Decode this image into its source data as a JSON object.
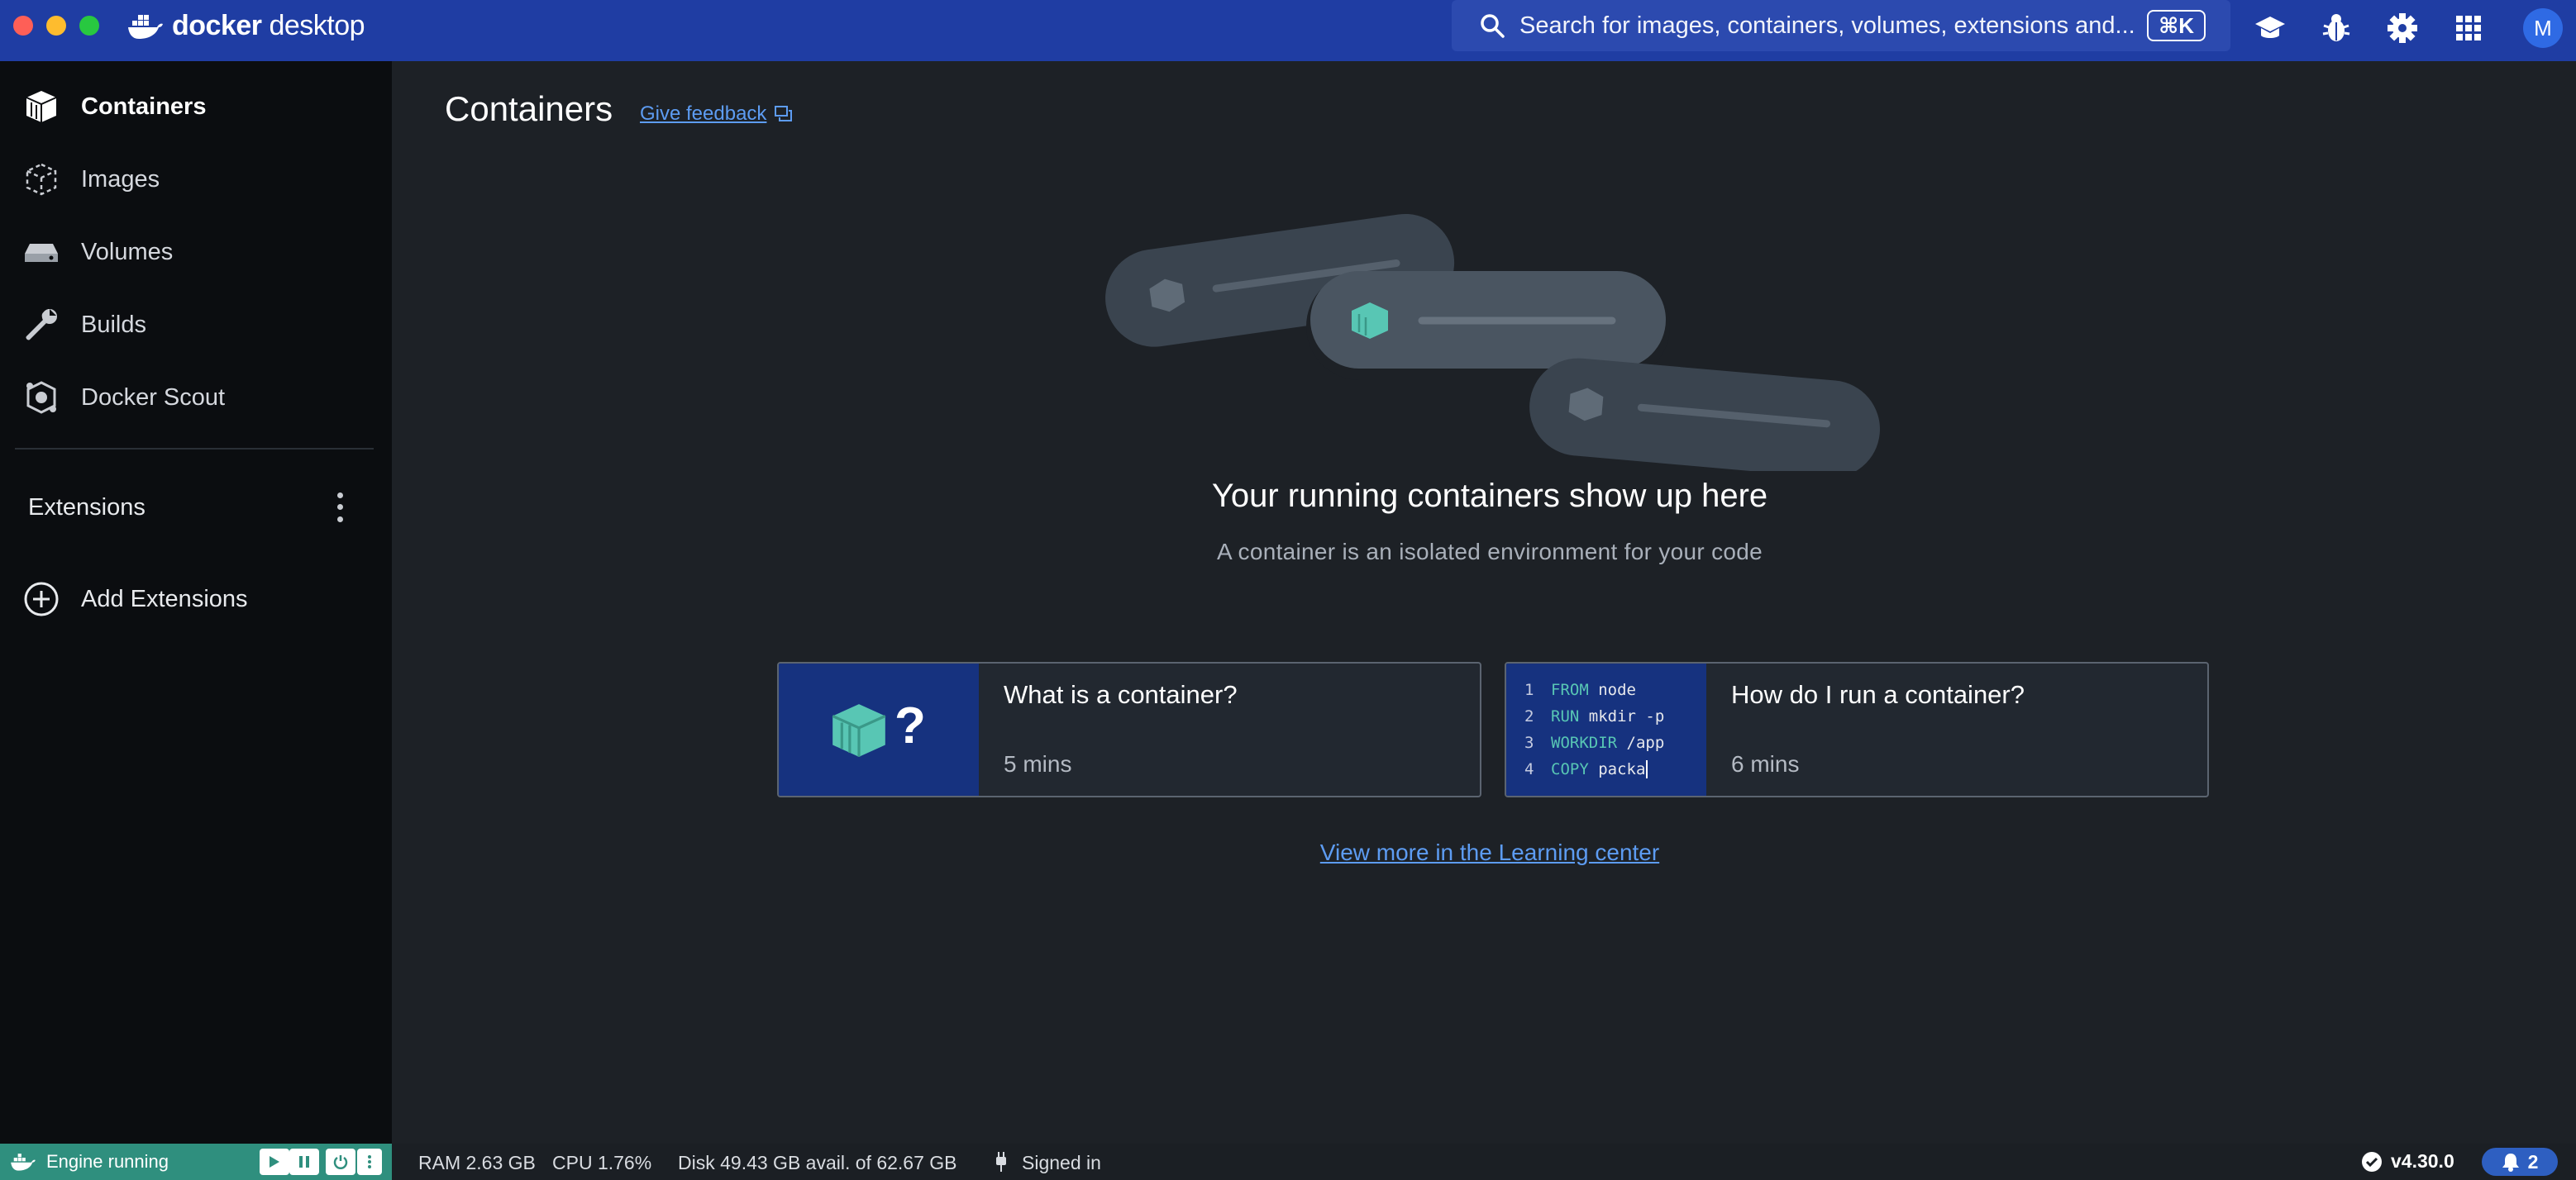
{
  "app": {
    "name_prefix": "docker",
    "name_suffix": "desktop"
  },
  "search": {
    "placeholder": "Search for images, containers, volumes, extensions and...",
    "shortcut": "⌘K"
  },
  "user": {
    "avatar_initial": "M"
  },
  "sidebar": {
    "items": [
      {
        "label": "Containers",
        "icon": "containers-icon"
      },
      {
        "label": "Images",
        "icon": "images-icon"
      },
      {
        "label": "Volumes",
        "icon": "volumes-icon"
      },
      {
        "label": "Builds",
        "icon": "wrench-icon"
      },
      {
        "label": "Docker Scout",
        "icon": "scout-icon"
      }
    ],
    "extensions_label": "Extensions",
    "add_extensions_label": "Add Extensions"
  },
  "main": {
    "title": "Containers",
    "feedback": "Give feedback",
    "empty_title": "Your running containers show up here",
    "empty_subtitle": "A container is an isolated environment for your code",
    "cards": [
      {
        "title": "What is a container?",
        "meta": "5 mins",
        "thumb_symbol": "?"
      },
      {
        "title": "How do I run a container?",
        "meta": "6 mins",
        "code": [
          {
            "n": "1",
            "kw": "FROM",
            "rest": " node"
          },
          {
            "n": "2",
            "kw": "RUN",
            "rest": " mkdir -p"
          },
          {
            "n": "3",
            "kw": "WORKDIR",
            "rest": " /app"
          },
          {
            "n": "4",
            "kw": "COPY",
            "rest": " packa"
          }
        ]
      }
    ],
    "learning_link": "View more in the Learning center"
  },
  "status": {
    "engine": "Engine running",
    "ram": "RAM 2.63 GB",
    "cpu": "CPU 1.76%",
    "disk": "Disk 49.43 GB avail. of 62.67 GB",
    "signed_in": "Signed in",
    "version": "v4.30.0",
    "notifications": "2"
  },
  "colors": {
    "titlebar": "#1f3da3",
    "accent": "#5d9cf2",
    "engine": "#2f8f7e",
    "container_teal": "#58c6b4"
  }
}
